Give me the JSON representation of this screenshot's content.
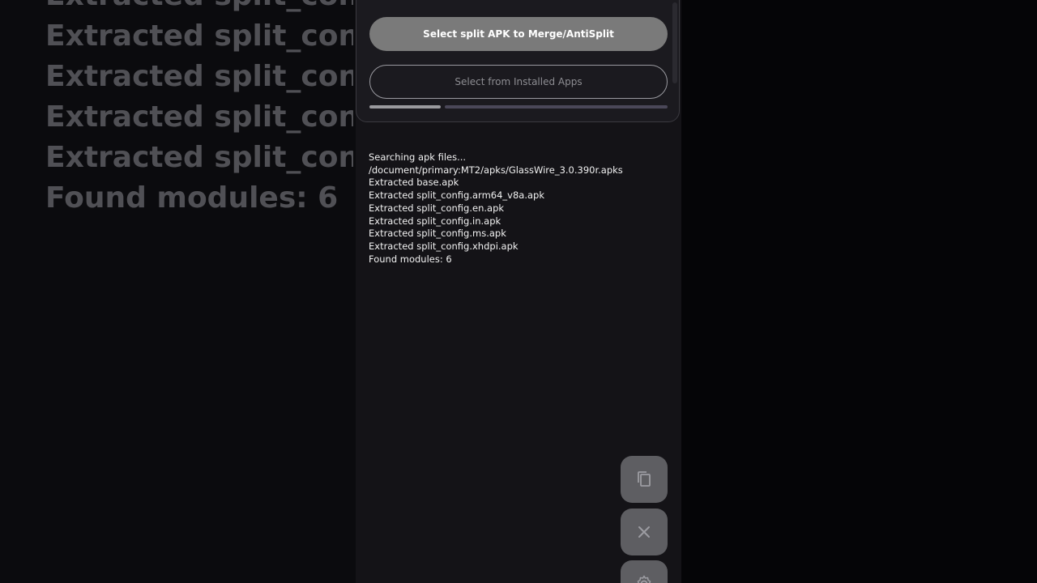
{
  "background_text": {
    "lines": [
      "Extracted split_config.ms.apk",
      "Extracted split_config",
      "Extracted split_config",
      "Extracted split_config",
      "Extracted split_config",
      "Found modules: 6"
    ]
  },
  "actions": {
    "primary_label": "Select split APK to Merge/AntiSplit",
    "secondary_label": "Select from Installed Apps"
  },
  "progress": {
    "fraction": 0.24
  },
  "log": {
    "lines": [
      "Searching apk files...",
      "/document/primary:MT2/apks/GlassWire_3.0.390r.apks",
      "Extracted base.apk",
      "Extracted split_config.arm64_v8a.apk",
      "Extracted split_config.en.apk",
      "Extracted split_config.in.apk",
      "Extracted split_config.ms.apk",
      "Extracted split_config.xhdpi.apk",
      "Found modules: 6"
    ]
  },
  "fabs": [
    {
      "icon": "copy-icon"
    },
    {
      "icon": "close-icon"
    },
    {
      "icon": "settings-icon"
    }
  ],
  "colors": {
    "primary_button": "#7a7a7a",
    "outline_border": "#9a9aa0",
    "progress_fill": "#9a9a9e",
    "progress_track": "#4a4758",
    "fab": "#5e5e62"
  }
}
